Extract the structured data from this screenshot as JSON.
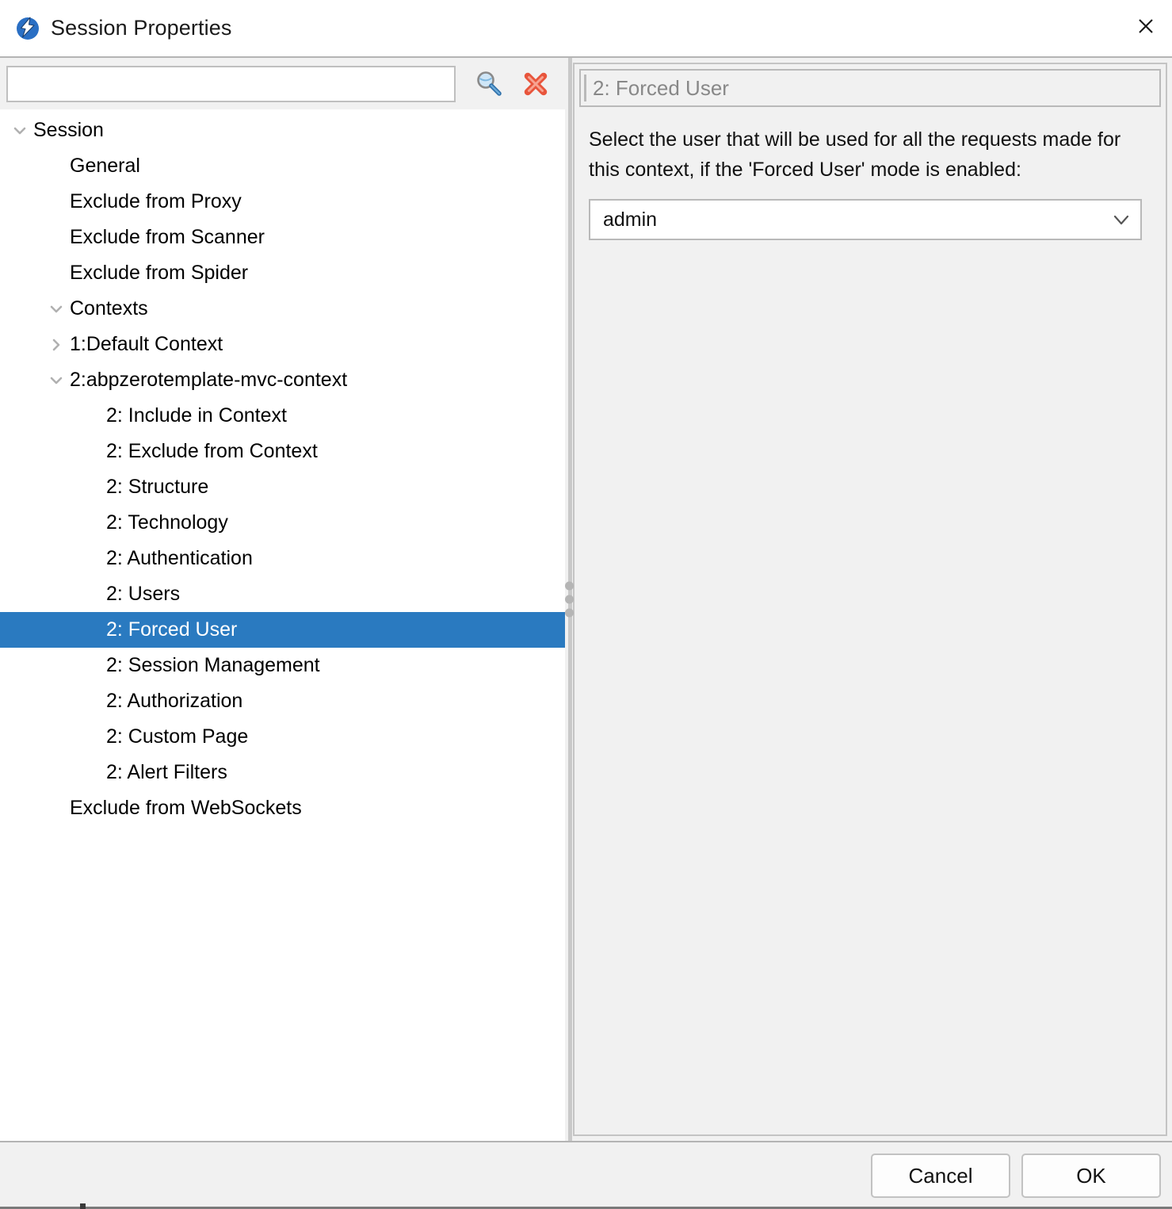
{
  "window": {
    "title": "Session Properties",
    "app_icon": "zap-logo-icon",
    "close_label": "×"
  },
  "search": {
    "value": "",
    "placeholder": "",
    "find_icon": "magnifier-icon",
    "clear_icon": "red-x-clear-icon"
  },
  "tree": {
    "items": [
      {
        "label": "Session",
        "depth": 0,
        "toggle": "expanded",
        "selected": false
      },
      {
        "label": "General",
        "depth": 1,
        "toggle": "none",
        "selected": false
      },
      {
        "label": "Exclude from Proxy",
        "depth": 1,
        "toggle": "none",
        "selected": false
      },
      {
        "label": "Exclude from Scanner",
        "depth": 1,
        "toggle": "none",
        "selected": false
      },
      {
        "label": "Exclude from Spider",
        "depth": 1,
        "toggle": "none",
        "selected": false
      },
      {
        "label": "Contexts",
        "depth": 1,
        "toggle": "expanded",
        "selected": false
      },
      {
        "label": "1:Default Context",
        "depth": 2,
        "toggle": "collapsed",
        "selected": false
      },
      {
        "label": "2:abpzerotemplate-mvc-context",
        "depth": 2,
        "toggle": "expanded",
        "selected": false
      },
      {
        "label": "2: Include in Context",
        "depth": 3,
        "toggle": "none",
        "selected": false
      },
      {
        "label": "2: Exclude from Context",
        "depth": 3,
        "toggle": "none",
        "selected": false
      },
      {
        "label": "2: Structure",
        "depth": 3,
        "toggle": "none",
        "selected": false
      },
      {
        "label": "2: Technology",
        "depth": 3,
        "toggle": "none",
        "selected": false
      },
      {
        "label": "2: Authentication",
        "depth": 3,
        "toggle": "none",
        "selected": false
      },
      {
        "label": "2: Users",
        "depth": 3,
        "toggle": "none",
        "selected": false
      },
      {
        "label": "2: Forced User",
        "depth": 3,
        "toggle": "none",
        "selected": true
      },
      {
        "label": "2: Session Management",
        "depth": 3,
        "toggle": "none",
        "selected": false
      },
      {
        "label": "2: Authorization",
        "depth": 3,
        "toggle": "none",
        "selected": false
      },
      {
        "label": "2: Custom Page",
        "depth": 3,
        "toggle": "none",
        "selected": false
      },
      {
        "label": "2: Alert Filters",
        "depth": 3,
        "toggle": "none",
        "selected": false
      },
      {
        "label": "Exclude from WebSockets",
        "depth": 1,
        "toggle": "none",
        "selected": false
      }
    ]
  },
  "panel": {
    "header_title": "2: Forced User",
    "description": "Select the user that will be used for all the requests made for this context, if the 'Forced User' mode is enabled:",
    "forced_user": {
      "selected": "admin",
      "options": [
        "admin"
      ]
    }
  },
  "footer": {
    "cancel_label": "Cancel",
    "ok_label": "OK"
  },
  "colors": {
    "selection": "#2a7ac0",
    "dialog_bg": "#f1f1f1",
    "tree_bg": "#ffffff",
    "header_text": "#888888",
    "clear_icon": "#e8553c"
  }
}
